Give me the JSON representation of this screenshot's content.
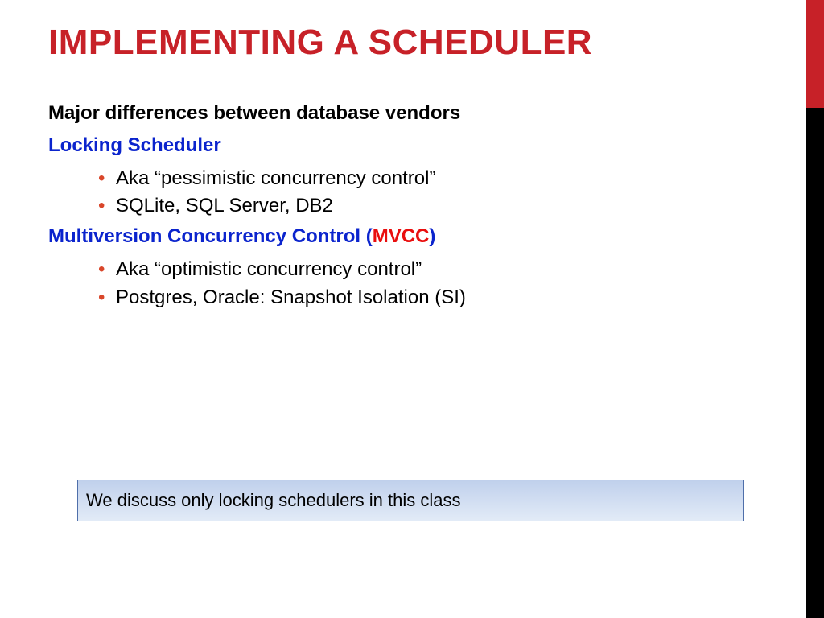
{
  "title": "IMPLEMENTING A SCHEDULER",
  "subhead": "Major differences between database vendors",
  "sections": [
    {
      "heading_plain": "Locking Scheduler",
      "heading_red": "",
      "heading_suffix": "",
      "bullets": [
        "Aka “pessimistic concurrency control”",
        "SQLite, SQL Server, DB2"
      ]
    },
    {
      "heading_plain": "Multiversion Concurrency Control (",
      "heading_red": "MVCC",
      "heading_suffix": ")",
      "bullets": [
        "Aka “optimistic concurrency control”",
        "Postgres, Oracle: Snapshot Isolation (SI)"
      ]
    }
  ],
  "callout": "We discuss only locking schedulers in this class"
}
